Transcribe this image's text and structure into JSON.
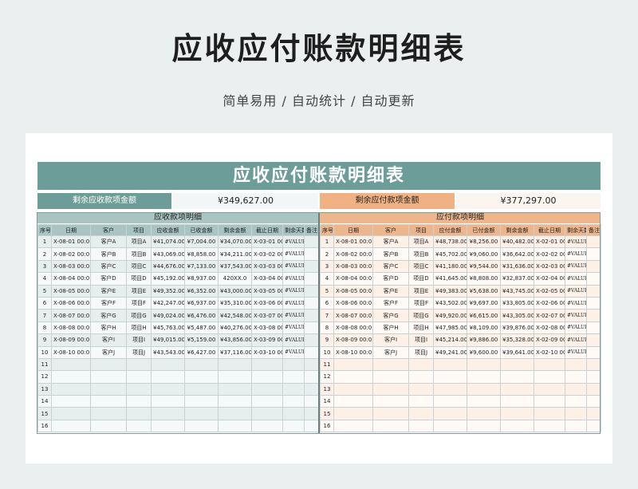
{
  "page": {
    "title": "应收应付账款明细表",
    "subtitle": "简单易用 / 自动统计 / 自动更新"
  },
  "sheet": {
    "title": "应收应付账款明细表",
    "receivable_summary_label": "剩余应收款项金额",
    "receivable_summary_value": "¥349,627.00",
    "payable_summary_label": "剩余应付款项金额",
    "payable_summary_value": "¥377,297.00"
  },
  "receivable": {
    "section_title": "应收款项明细",
    "headers": [
      "序号",
      "日期",
      "客户",
      "项目",
      "应收金额",
      "已收金额",
      "剩余金额",
      "截止日期",
      "剩余天数",
      "备注"
    ],
    "rows": [
      [
        "1",
        "X-08-01 00:0",
        "客户A",
        "项目A",
        "¥41,074.00",
        "¥7,004.00",
        "¥34,070.00",
        "X-03-01 00:0",
        "#VALUE!",
        ""
      ],
      [
        "2",
        "X-08-02 00:0",
        "客户B",
        "项目B",
        "¥43,069.00",
        "¥8,858.00",
        "¥34,211.00",
        "X-03-02 00:0",
        "#VALUE!",
        ""
      ],
      [
        "3",
        "X-08-03 00:0",
        "客户C",
        "项目C",
        "¥44,676.00",
        "¥7,133.00",
        "¥37,543.00",
        "X-03-03 00:0",
        "#VALUE!",
        ""
      ],
      [
        "4",
        "X-08-04 00:0",
        "客户D",
        "项目D",
        "¥45,192.00",
        "¥8,937.00",
        "420XX.0",
        "X-03-04 00:0",
        "#VALUE!",
        ""
      ],
      [
        "5",
        "X-08-05 00:0",
        "客户E",
        "项目E",
        "¥49,352.00",
        "¥6,352.00",
        "¥43,000.00",
        "X-03-05 00:0",
        "#VALUE!",
        ""
      ],
      [
        "6",
        "X-08-06 00:0",
        "客户F",
        "项目F",
        "¥42,247.00",
        "¥6,937.00",
        "¥35,310.00",
        "X-03-06 00:0",
        "#VALUE!",
        ""
      ],
      [
        "7",
        "X-08-07 00:0",
        "客户G",
        "项目G",
        "¥49,024.00",
        "¥6,476.00",
        "¥42,548.00",
        "X-03-07 00:0",
        "#VALUE!",
        ""
      ],
      [
        "8",
        "X-08-08 00:0",
        "客户H",
        "项目H",
        "¥45,763.00",
        "¥5,487.00",
        "¥40,276.00",
        "X-03-08 00:0",
        "#VALUE!",
        ""
      ],
      [
        "9",
        "X-08-09 00:0",
        "客户I",
        "项目I",
        "¥49,015.00",
        "¥5,159.00",
        "¥43,856.00",
        "X-03-09 00:0",
        "#VALUE!",
        ""
      ],
      [
        "10",
        "X-08-10 00:0",
        "客户J",
        "项目J",
        "¥43,543.00",
        "¥6,427.00",
        "¥37,116.00",
        "X-03-10 00:0",
        "#VALUE!",
        ""
      ],
      [
        "11",
        "",
        "",
        "",
        "",
        "",
        "",
        "",
        "",
        ""
      ],
      [
        "12",
        "",
        "",
        "",
        "",
        "",
        "",
        "",
        "",
        ""
      ],
      [
        "13",
        "",
        "",
        "",
        "",
        "",
        "",
        "",
        "",
        ""
      ],
      [
        "14",
        "",
        "",
        "",
        "",
        "",
        "",
        "",
        "",
        ""
      ],
      [
        "15",
        "",
        "",
        "",
        "",
        "",
        "",
        "",
        "",
        ""
      ],
      [
        "16",
        "",
        "",
        "",
        "",
        "",
        "",
        "",
        "",
        ""
      ]
    ]
  },
  "payable": {
    "section_title": "应付款项明细",
    "headers": [
      "序号",
      "日期",
      "客户",
      "项目",
      "应付金额",
      "已付金额",
      "剩余金额",
      "截止日期",
      "剩余天数",
      "备注"
    ],
    "rows": [
      [
        "1",
        "X-08-01 00:0",
        "客户A",
        "项目A",
        "¥48,738.00",
        "¥8,256.00",
        "¥40,482.00",
        "X-02-01 00:0",
        "#VALUE!",
        ""
      ],
      [
        "2",
        "X-08-02 00:0",
        "客户B",
        "项目B",
        "¥45,702.00",
        "¥9,060.00",
        "¥36,642.00",
        "X-02-02 00:0",
        "#VALUE!",
        ""
      ],
      [
        "3",
        "X-08-03 00:0",
        "客户C",
        "项目C",
        "¥41,180.00",
        "¥9,544.00",
        "¥31,636.00",
        "X-02-03 00:0",
        "#VALUE!",
        ""
      ],
      [
        "4",
        "X-08-04 00:0",
        "客户D",
        "项目D",
        "¥41,645.00",
        "¥8,808.00",
        "¥32,837.00",
        "X-02-04 00:0",
        "#VALUE!",
        ""
      ],
      [
        "5",
        "X-08-05 00:0",
        "客户E",
        "项目E",
        "¥49,383.00",
        "¥5,638.00",
        "¥43,745.00",
        "X-02-05 00:0",
        "#VALUE!",
        ""
      ],
      [
        "6",
        "X-08-06 00:0",
        "客户F",
        "项目F",
        "¥43,502.00",
        "¥9,697.00",
        "¥33,805.00",
        "X-02-06 00:0",
        "#VALUE!",
        ""
      ],
      [
        "7",
        "X-08-07 00:0",
        "客户G",
        "项目G",
        "¥49,920.00",
        "¥6,615.00",
        "¥43,305.00",
        "X-02-07 00:0",
        "#VALUE!",
        ""
      ],
      [
        "8",
        "X-08-08 00:0",
        "客户H",
        "项目H",
        "¥47,985.00",
        "¥8,109.00",
        "¥39,876.00",
        "X-02-08 00:0",
        "#VALUE!",
        ""
      ],
      [
        "9",
        "X-08-09 00:0",
        "客户I",
        "项目I",
        "¥45,214.00",
        "¥9,886.00",
        "¥35,328.00",
        "X-02-09 00:0",
        "#VALUE!",
        ""
      ],
      [
        "10",
        "X-08-10 00:0",
        "客户J",
        "项目J",
        "¥49,241.00",
        "¥9,600.00",
        "¥39,641.00",
        "X-02-10 00:0",
        "#VALUE!",
        ""
      ],
      [
        "11",
        "",
        "",
        "",
        "",
        "",
        "",
        "",
        "",
        ""
      ],
      [
        "12",
        "",
        "",
        "",
        "",
        "",
        "",
        "",
        "",
        ""
      ],
      [
        "13",
        "",
        "",
        "",
        "",
        "",
        "",
        "",
        "",
        ""
      ],
      [
        "14",
        "",
        "",
        "",
        "",
        "",
        "",
        "",
        "",
        ""
      ],
      [
        "15",
        "",
        "",
        "",
        "",
        "",
        "",
        "",
        "",
        ""
      ],
      [
        "16",
        "",
        "",
        "",
        "",
        "",
        "",
        "",
        "",
        ""
      ]
    ]
  },
  "colors": {
    "teal_header": "#6d9d98",
    "teal_light": "#a9c5c1",
    "orange_header": "#efb68c",
    "orange_summary": "#f0b283"
  }
}
